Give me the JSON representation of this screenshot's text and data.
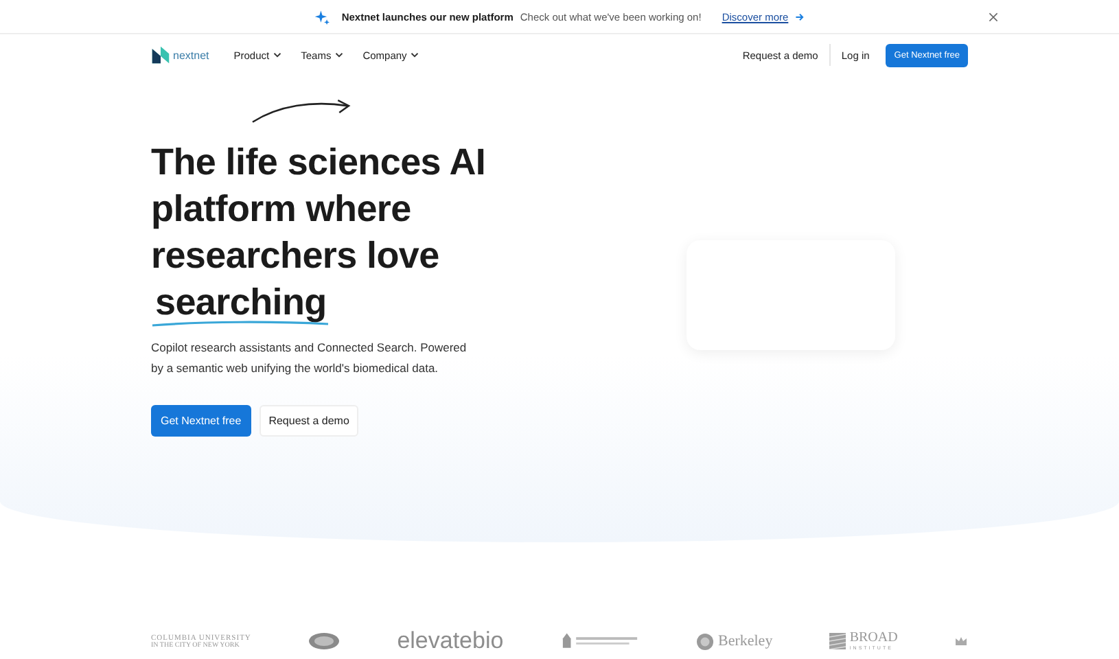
{
  "announcement": {
    "title": "Nextnet launches our new platform",
    "message": "Check out what we've been working on!",
    "link": "Discover more"
  },
  "nav": {
    "brand": "nextnet",
    "menus": [
      "Product",
      "Teams",
      "Company"
    ],
    "request_demo": "Request a demo",
    "login": "Log in",
    "cta": "Get Nextnet free"
  },
  "hero": {
    "headline": "The life sciences AI platform where researchers love",
    "highlight": "searching",
    "description": "Copilot research assistants and Connected Search. Powered by a semantic web unifying the world's biomedical data.",
    "primary": "Get Nextnet free",
    "secondary": "Request a demo"
  },
  "logos": [
    {
      "kind": "serif",
      "text": "COLUMBIA UNIVERSITY",
      "subtitle": "IN THE CITY OF NEW YORK"
    },
    {
      "kind": "emblem"
    },
    {
      "kind": "sans",
      "text": "elevatebio"
    },
    {
      "kind": "crest"
    },
    {
      "kind": "seal",
      "text": "Berkeley"
    },
    {
      "kind": "stripes",
      "text": "BROAD",
      "subtitle": "INSTITUTE"
    },
    {
      "kind": "crown"
    }
  ]
}
